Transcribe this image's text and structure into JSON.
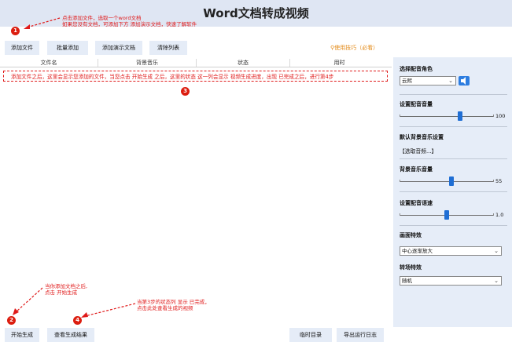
{
  "title": "Word文档转成视频",
  "annotations": {
    "a1_line1": "点击添加文件，选取一个word文档",
    "a1_line2": "如果您没有文档，可添加下方 添加演示文档，快速了解软件",
    "a2_line1": "当你添加文档之后,",
    "a2_line2": "点击 开始生成",
    "a4_line1": "当第3步的状态列 显示 已完成，",
    "a4_line2": "点击此处查看生成的视频",
    "badge1": "1",
    "badge2": "2",
    "badge3": "3",
    "badge4": "4"
  },
  "toolbar": {
    "add_file": "添加文件",
    "batch_add": "批量添加",
    "add_demo": "添加演示文档",
    "clear_list": "清除列表",
    "tips": "使用技巧（必看）"
  },
  "table": {
    "columns": [
      "文件名",
      "背景音乐",
      "状态",
      "用时"
    ],
    "hint_row": "添加文件之后，这里会显示您添加的文件，当您点击 开始生成 之后，这里的状态 这一列会显示 视频生成进度，出现 已完成之后，进行第4步"
  },
  "bottom": {
    "start": "开始生成",
    "view_result": "查看生成结果",
    "temp_dir": "临时目录",
    "export_log": "导出运行日志"
  },
  "sidebar": {
    "voice_label": "选择配音角色",
    "voice_value": "云熙",
    "voice_volume_label": "设置配音音量",
    "voice_volume": "100",
    "default_bg_label": "默认背景音乐设置",
    "default_bg_value": "【选取音频...】",
    "bg_volume_label": "背景音乐音量",
    "bg_volume": "55",
    "speed_label": "设置配音语速",
    "speed": "1.0",
    "effect_label": "画面特效",
    "effect_value": "中心逐渐放大",
    "transition_label": "转场特效",
    "transition_value": "随机"
  },
  "colors": {
    "accent": "#1f6ed4",
    "annotation": "#e01a1a",
    "tips": "#e38a17",
    "sidebar_bg": "#e6edf8",
    "button_bg": "#e5ecf7"
  }
}
